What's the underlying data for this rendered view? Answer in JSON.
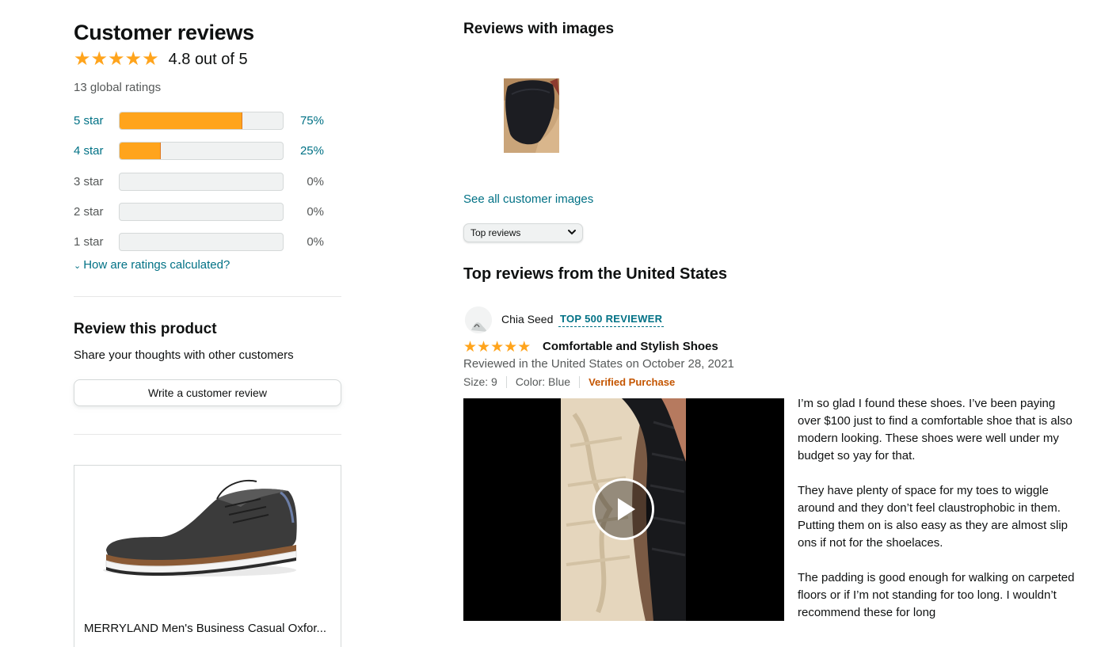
{
  "summary": {
    "title": "Customer reviews",
    "stars_rating": 4.8,
    "average_text": "4.8 out of 5",
    "global_ratings": "13 global ratings",
    "histogram": [
      {
        "label": "5 star",
        "percent_text": "75%",
        "percent": 75
      },
      {
        "label": "4 star",
        "percent_text": "25%",
        "percent": 25
      },
      {
        "label": "3 star",
        "percent_text": "0%",
        "percent": 0
      },
      {
        "label": "2 star",
        "percent_text": "0%",
        "percent": 0
      },
      {
        "label": "1 star",
        "percent_text": "0%",
        "percent": 0
      }
    ],
    "how_calculated": "How are ratings calculated?"
  },
  "review_product": {
    "title": "Review this product",
    "subtitle": "Share your thoughts with other customers",
    "button_label": "Write a customer review"
  },
  "product_card": {
    "title": "MERRYLAND Men's Business Casual Oxfor..."
  },
  "images_section": {
    "title": "Reviews with images",
    "see_all": "See all customer images"
  },
  "sort": {
    "selected": "Top reviews"
  },
  "top_reviews": {
    "heading": "Top reviews from the United States",
    "reviews": [
      {
        "reviewer": "Chia Seed",
        "badge": "TOP 500 REVIEWER",
        "stars": 5,
        "title": "Comfortable and Stylish Shoes",
        "date": "Reviewed in the United States on October 28, 2021",
        "size": "Size: 9",
        "color": "Color: Blue",
        "verified": "Verified Purchase",
        "body": [
          " I’m so glad I found these shoes. I’ve been paying over $100 just to find a comfortable shoe that is also modern looking. These shoes were well under my budget so yay for that.",
          "They have plenty of space for my toes to wiggle around and they don’t feel claustrophobic in them.",
          "Putting them on is also easy as they are almost slip ons if not for the shoelaces.",
          "The padding is good enough for walking on carpeted floors or if I’m not standing for too long. I wouldn’t recommend these for long"
        ]
      }
    ]
  },
  "colors": {
    "star": "#ffa41c",
    "link": "#007185",
    "verified": "#c45500",
    "muted": "#565959"
  },
  "icons": [
    "star-icon",
    "chevron-down-icon",
    "play-icon",
    "avatar-icon"
  ]
}
